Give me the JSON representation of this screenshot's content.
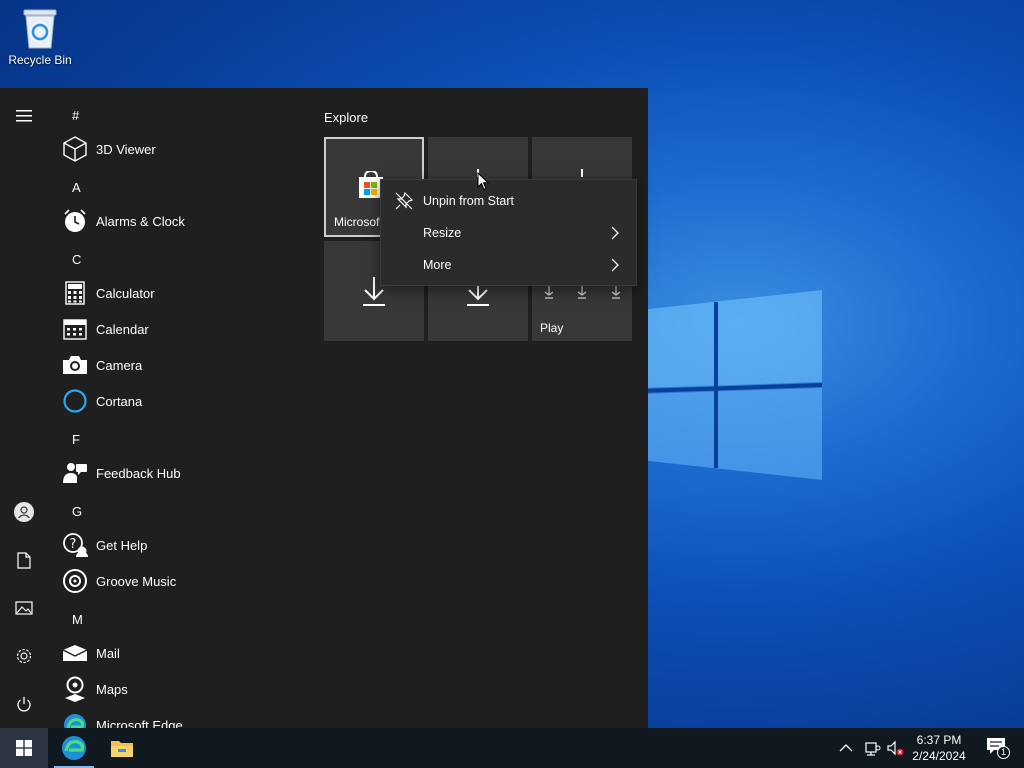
{
  "desktop": {
    "icons": [
      {
        "label": "Recycle Bin",
        "icon": "recycle-bin-icon"
      }
    ]
  },
  "start_menu": {
    "rail": [
      {
        "icon": "hamburger-menu-icon"
      },
      {
        "icon": "user-account-icon"
      },
      {
        "icon": "documents-icon"
      },
      {
        "icon": "pictures-icon"
      },
      {
        "icon": "settings-gear-icon"
      },
      {
        "icon": "power-icon"
      }
    ],
    "app_list": {
      "groups": [
        {
          "letter": "#",
          "apps": [
            {
              "name": "3D Viewer",
              "icon": "3d-viewer-icon"
            }
          ]
        },
        {
          "letter": "A",
          "apps": [
            {
              "name": "Alarms & Clock",
              "icon": "alarms-clock-icon"
            }
          ]
        },
        {
          "letter": "C",
          "apps": [
            {
              "name": "Calculator",
              "icon": "calculator-icon"
            },
            {
              "name": "Calendar",
              "icon": "calendar-icon"
            },
            {
              "name": "Camera",
              "icon": "camera-icon"
            },
            {
              "name": "Cortana",
              "icon": "cortana-icon"
            }
          ]
        },
        {
          "letter": "F",
          "apps": [
            {
              "name": "Feedback Hub",
              "icon": "feedback-hub-icon"
            }
          ]
        },
        {
          "letter": "G",
          "apps": [
            {
              "name": "Get Help",
              "icon": "get-help-icon"
            },
            {
              "name": "Groove Music",
              "icon": "groove-music-icon"
            }
          ]
        },
        {
          "letter": "M",
          "apps": [
            {
              "name": "Mail",
              "icon": "mail-icon"
            },
            {
              "name": "Maps",
              "icon": "maps-icon"
            },
            {
              "name": "Microsoft Edge",
              "icon": "edge-icon"
            }
          ]
        }
      ]
    },
    "tiles_section": {
      "title": "Explore",
      "tiles": [
        {
          "label": "Microsoft",
          "icon": "microsoft-store-icon",
          "selected": true
        },
        {
          "label": "",
          "icon": "download-icon"
        },
        {
          "label": "",
          "icon": "download-icon"
        },
        {
          "label": "",
          "icon": "download-icon"
        },
        {
          "label": "",
          "icon": "download-icon"
        },
        {
          "label": "Play",
          "icon": "download-icon"
        }
      ]
    }
  },
  "context_menu": {
    "items": [
      {
        "label": "Unpin from Start",
        "icon": "unpin-icon",
        "submenu": false
      },
      {
        "label": "Resize",
        "submenu": true
      },
      {
        "label": "More",
        "submenu": true
      }
    ]
  },
  "taskbar": {
    "buttons": [
      {
        "icon": "windows-start-icon"
      },
      {
        "icon": "edge-icon",
        "active": true
      },
      {
        "icon": "file-explorer-icon"
      }
    ],
    "tray": {
      "icons": [
        "chevron-up-icon",
        "network-icon",
        "volume-muted-icon"
      ],
      "time": "6:37 PM",
      "date": "2/24/2024",
      "notification_count": "1"
    }
  },
  "colors": {
    "start_bg": "#1f1f1f",
    "tile_bg": "#383838",
    "menu_bg": "#2b2b2b",
    "taskbar_bg": "#101820",
    "accent": "#0b4fb4"
  }
}
